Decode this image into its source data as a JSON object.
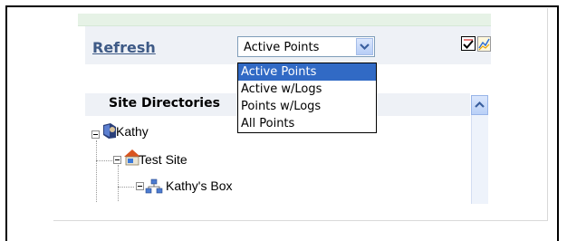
{
  "toolbar": {
    "refresh_label": "Refresh",
    "points_select": {
      "selected": "Active Points",
      "options": [
        "Active Points",
        "Active w/Logs",
        "Points w/Logs",
        "All Points"
      ]
    }
  },
  "site_directories": {
    "title": "Site Directories",
    "tree": [
      {
        "label": "Kathy",
        "icon": "user-book-icon"
      },
      {
        "label": "Test Site",
        "icon": "house-icon"
      },
      {
        "label": "Kathy's Box",
        "icon": "network-icon"
      }
    ]
  },
  "colors": {
    "link": "#3e5a86",
    "selection": "#316ac5",
    "header_band": "#eef1f6"
  }
}
